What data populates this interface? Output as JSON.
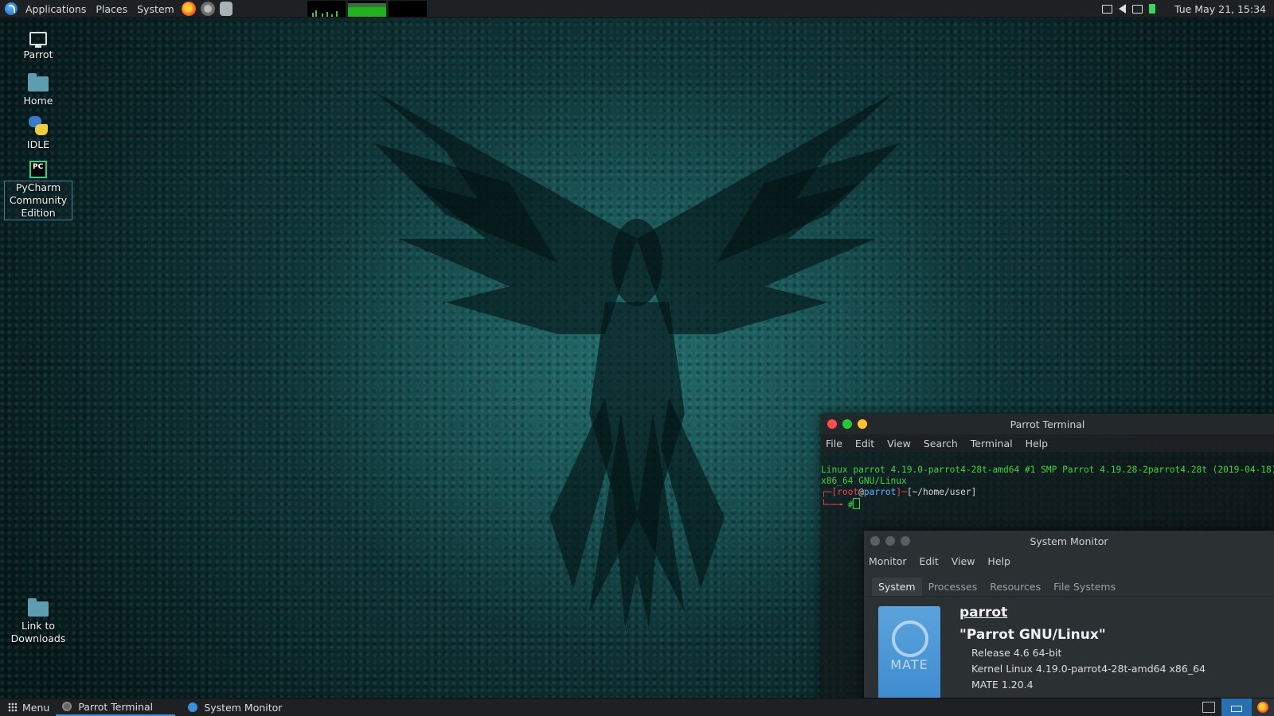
{
  "top_panel": {
    "applications": "Applications",
    "places": "Places",
    "system": "System",
    "clock": "Tue May 21, 15:34"
  },
  "desktop_icons": {
    "parrot": "Parrot",
    "home": "Home",
    "idle": "IDLE",
    "pycharm_line1": "PyCharm",
    "pycharm_line2": "Community",
    "pycharm_line3": "Edition",
    "downloads_line1": "Link to",
    "downloads_line2": "Downloads"
  },
  "terminal": {
    "title": "Parrot Terminal",
    "menu": [
      "File",
      "Edit",
      "View",
      "Search",
      "Terminal",
      "Help"
    ],
    "line1": "Linux parrot 4.19.0-parrot4-28t-amd64 #1 SMP Parrot 4.19.28-2parrot4.28t (2019-04-18)",
    "line2": "x86_64 GNU/Linux",
    "prompt_user": "root",
    "prompt_at": "@",
    "prompt_host": "parrot",
    "prompt_path": "[~/home/user]",
    "prompt_symbol": "#"
  },
  "system_monitor": {
    "title": "System Monitor",
    "menu": [
      "Monitor",
      "Edit",
      "View",
      "Help"
    ],
    "tabs": [
      "System",
      "Processes",
      "Resources",
      "File Systems"
    ],
    "hostname": "parrot",
    "os_name": "\"Parrot GNU/Linux\"",
    "release": "Release 4.6 64-bit",
    "kernel": "Kernel Linux 4.19.0-parrot4-28t-amd64 x86_64",
    "mate": "MATE 1.20.4",
    "logo_text": "MATE"
  },
  "bottom_panel": {
    "menu": "Menu",
    "tasks": [
      "Parrot Terminal",
      "System Monitor"
    ]
  },
  "colors": {
    "panel": "#1d2124",
    "accent": "#3b8ed8",
    "terminal_green": "#3bd43b"
  }
}
